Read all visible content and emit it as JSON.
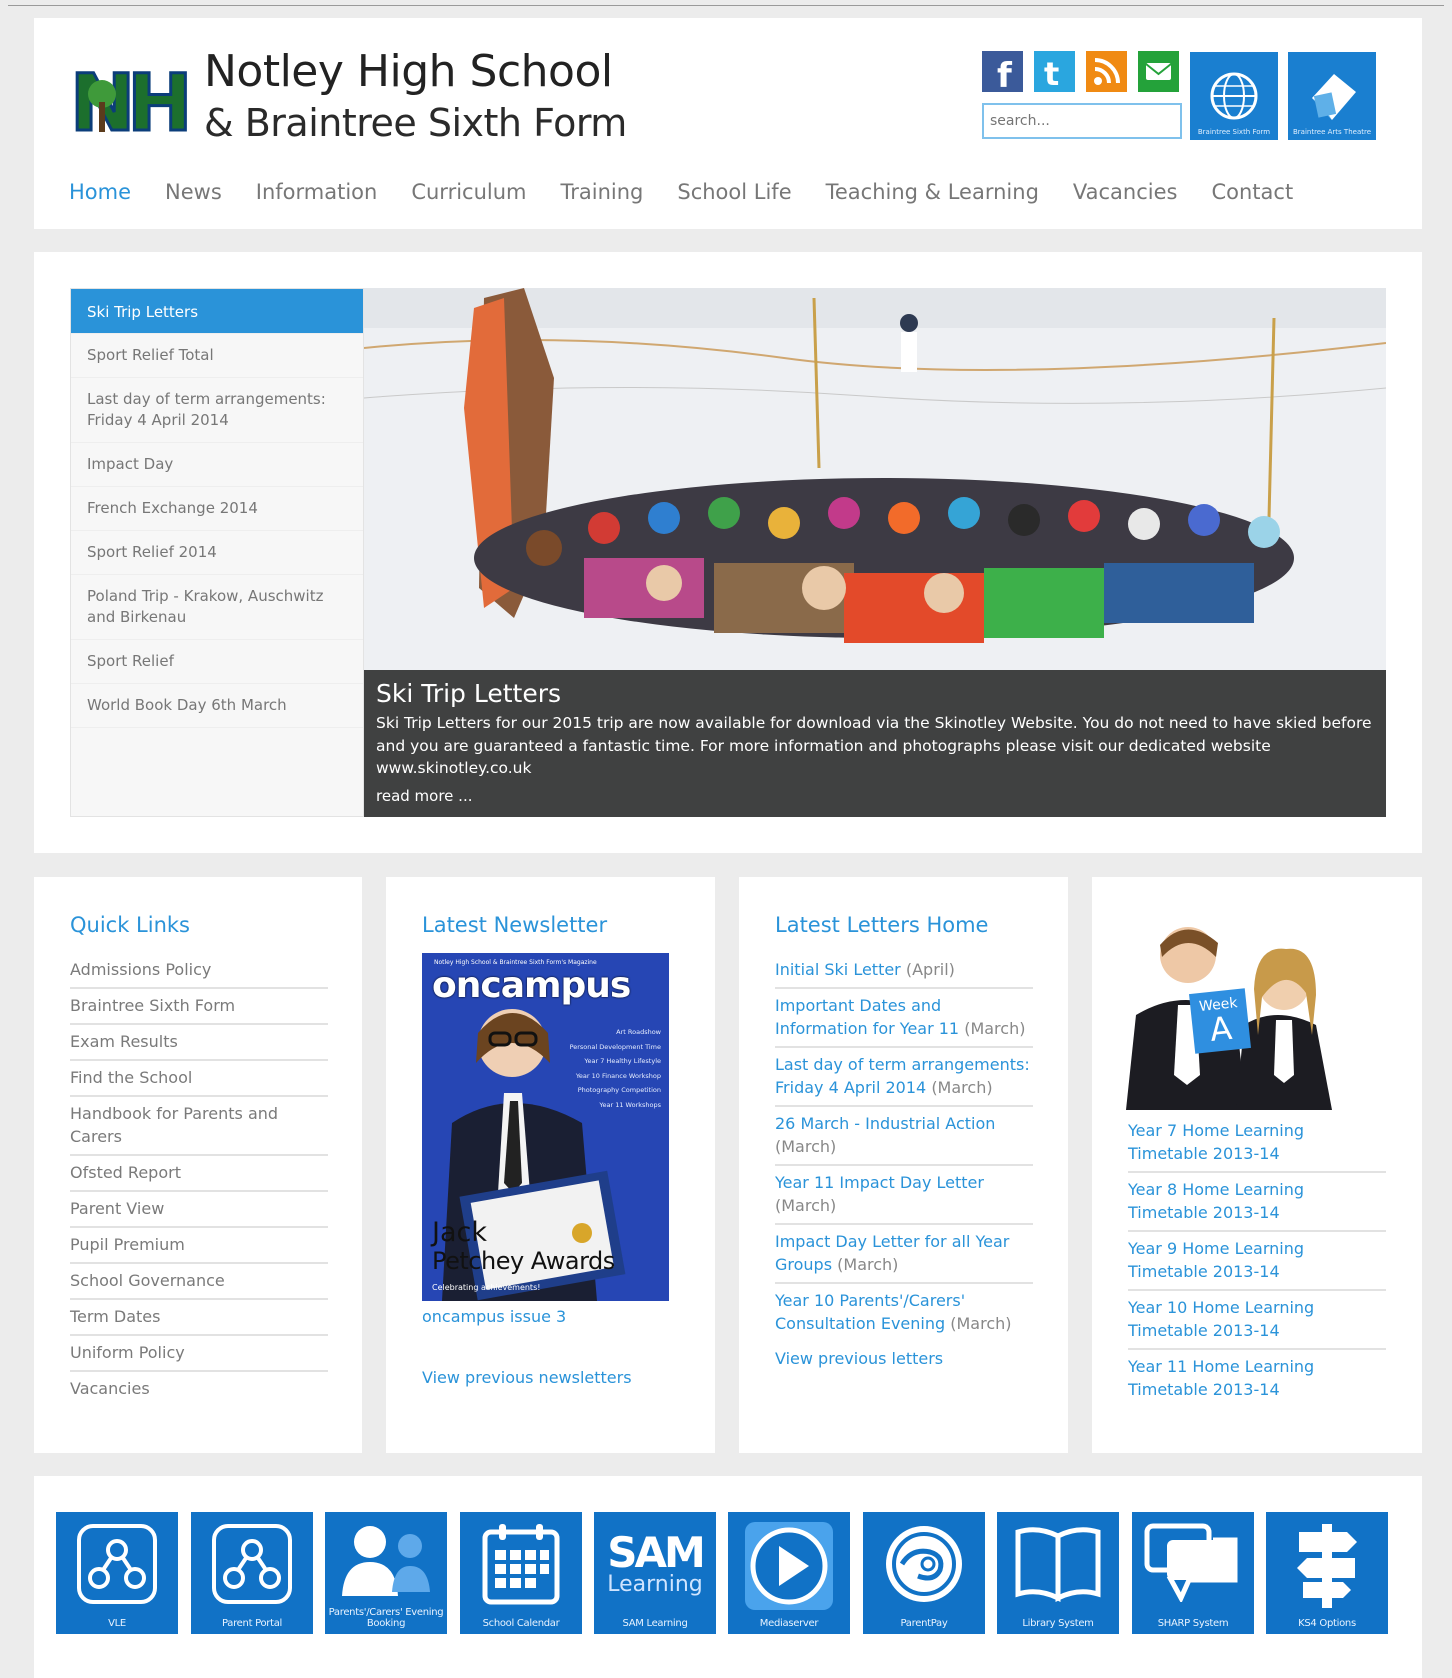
{
  "header": {
    "title": "Notley High School",
    "subtitle": "& Braintree Sixth Form",
    "search_placeholder": "search...",
    "tile1_label": "Braintree Sixth Form",
    "tile2_label": "Braintree Arts Theatre",
    "social": [
      "facebook-icon",
      "twitter-icon",
      "rss-icon",
      "email-icon"
    ]
  },
  "nav": [
    "Home",
    "News",
    "Information",
    "Curriculum",
    "Training",
    "School Life",
    "Teaching & Learning",
    "Vacancies",
    "Contact"
  ],
  "slider": {
    "items": [
      "Ski Trip Letters",
      "Sport Relief Total",
      "Last day of term arrangements: Friday 4 April 2014",
      "Impact Day",
      "French Exchange 2014",
      "Sport Relief 2014",
      "Poland Trip - Krakow, Auschwitz and Birkenau",
      "Sport Relief",
      "World Book Day 6th March"
    ],
    "caption_title": "Ski Trip Letters",
    "caption_text": "Ski Trip Letters for our 2015 trip are now available for download via the Skinotley Website. You do not need to have skied before and you are guaranteed a fantastic time. For more information and photographs please visit our dedicated website www.skinotley.co.uk",
    "read_more": "read more ..."
  },
  "quick_links": {
    "title": "Quick Links",
    "items": [
      "Admissions Policy",
      "Braintree Sixth Form",
      "Exam Results",
      "Find the School",
      "Handbook for Parents and Carers",
      "Ofsted Report",
      "Parent View",
      "Pupil Premium",
      "School Governance",
      "Term Dates",
      "Uniform Policy",
      "Vacancies"
    ]
  },
  "newsletter": {
    "title": "Latest Newsletter",
    "cover_masthead": "oncampus",
    "cover_kicker": "Notley High School & Braintree Sixth Form's Magazine",
    "cover_contents": [
      "Art Roadshow",
      "Personal Development Time",
      "Year 7 Healthy Lifestyle",
      "Year 10 Finance Workshop",
      "Photography Competition",
      "Year 11 Workshops"
    ],
    "cover_headline1": "Jack",
    "cover_headline2": "Petchey Awards",
    "cover_tagline": "Celebrating achievements!",
    "issue": "oncampus issue 3",
    "previous": "View previous newsletters"
  },
  "letters": {
    "title": "Latest Letters Home",
    "items": [
      {
        "title": "Initial Ski Letter",
        "month": "(April)"
      },
      {
        "title": "Important Dates and Information for Year 11",
        "month": "(March)"
      },
      {
        "title": "Last day of term arrangements: Friday 4 April 2014",
        "month": "(March)"
      },
      {
        "title": "26 March - Industrial Action",
        "month": "(March)"
      },
      {
        "title": "Year 11 Impact Day Letter",
        "month": "(March)"
      },
      {
        "title": "Impact Day Letter for all Year Groups",
        "month": "(March)"
      },
      {
        "title": "Year 10 Parents'/Carers' Consultation Evening",
        "month": "(March)"
      }
    ],
    "previous": "View previous letters"
  },
  "home_learning": {
    "week_label": "Week",
    "week_letter": "A",
    "items": [
      "Year 7 Home Learning Timetable 2013-14",
      "Year 8 Home Learning Timetable 2013-14",
      "Year 9 Home Learning Timetable 2013-14",
      "Year 10 Home Learning Timetable 2013-14",
      "Year 11 Home Learning Timetable 2013-14"
    ]
  },
  "tools": [
    {
      "label": "VLE",
      "icon": "network-icon"
    },
    {
      "label": "Parent Portal",
      "icon": "network-icon"
    },
    {
      "label": "Parents'/Carers' Evening Booking",
      "icon": "people-icon"
    },
    {
      "label": "School Calendar",
      "icon": "calendar-icon"
    },
    {
      "label": "SAM Learning",
      "icon": "sam-logo-icon"
    },
    {
      "label": "Mediaserver",
      "icon": "play-icon"
    },
    {
      "label": "ParentPay",
      "icon": "parentpay-logo-icon"
    },
    {
      "label": "Library System",
      "icon": "book-icon"
    },
    {
      "label": "SHARP System",
      "icon": "speech-bubbles-icon"
    },
    {
      "label": "KS4 Options",
      "icon": "signpost-icon"
    }
  ],
  "tools_text": {
    "sam_big": "SAM",
    "sam_small": "Learning"
  },
  "colors": {
    "accent": "#2a93d9",
    "tile_blue": "#1172c6",
    "caption_bg": "#2e2e2e"
  }
}
